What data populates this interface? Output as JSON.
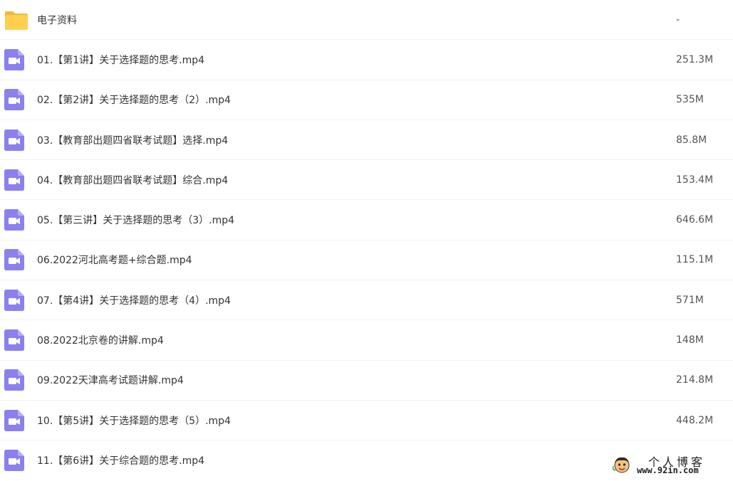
{
  "colors": {
    "folder": "#ffc944",
    "video": "#8a80ee",
    "divider": "#f1f2f4"
  },
  "files": [
    {
      "name": "电子资料",
      "size": "-",
      "icon": "folder-icon"
    },
    {
      "name": "01.【第1讲】关于选择题的思考.mp4",
      "size": "251.3M",
      "icon": "video-file-icon"
    },
    {
      "name": "02.【第2讲】关于选择题的思考（2）.mp4",
      "size": "535M",
      "icon": "video-file-icon"
    },
    {
      "name": "03.【教育部出题四省联考试题】选择.mp4",
      "size": "85.8M",
      "icon": "video-file-icon"
    },
    {
      "name": "04.【教育部出题四省联考试题】综合.mp4",
      "size": "153.4M",
      "icon": "video-file-icon"
    },
    {
      "name": "05.【第三讲】关于选择题的思考（3）.mp4",
      "size": "646.6M",
      "icon": "video-file-icon"
    },
    {
      "name": "06.2022河北高考题+综合题.mp4",
      "size": "115.1M",
      "icon": "video-file-icon"
    },
    {
      "name": "07.【第4讲】关于选择题的思考（4）.mp4",
      "size": "571M",
      "icon": "video-file-icon"
    },
    {
      "name": "08.2022北京卷的讲解.mp4",
      "size": "148M",
      "icon": "video-file-icon"
    },
    {
      "name": "09.2022天津高考试题讲解.mp4",
      "size": "214.8M",
      "icon": "video-file-icon"
    },
    {
      "name": "10.【第5讲】关于选择题的思考（5）.mp4",
      "size": "448.2M",
      "icon": "video-file-icon"
    },
    {
      "name": "11.【第6讲】关于综合题的思考.mp4",
      "size": "",
      "icon": "video-file-icon"
    }
  ],
  "watermark": {
    "title": "个人博客",
    "url": "www.92in.com"
  }
}
